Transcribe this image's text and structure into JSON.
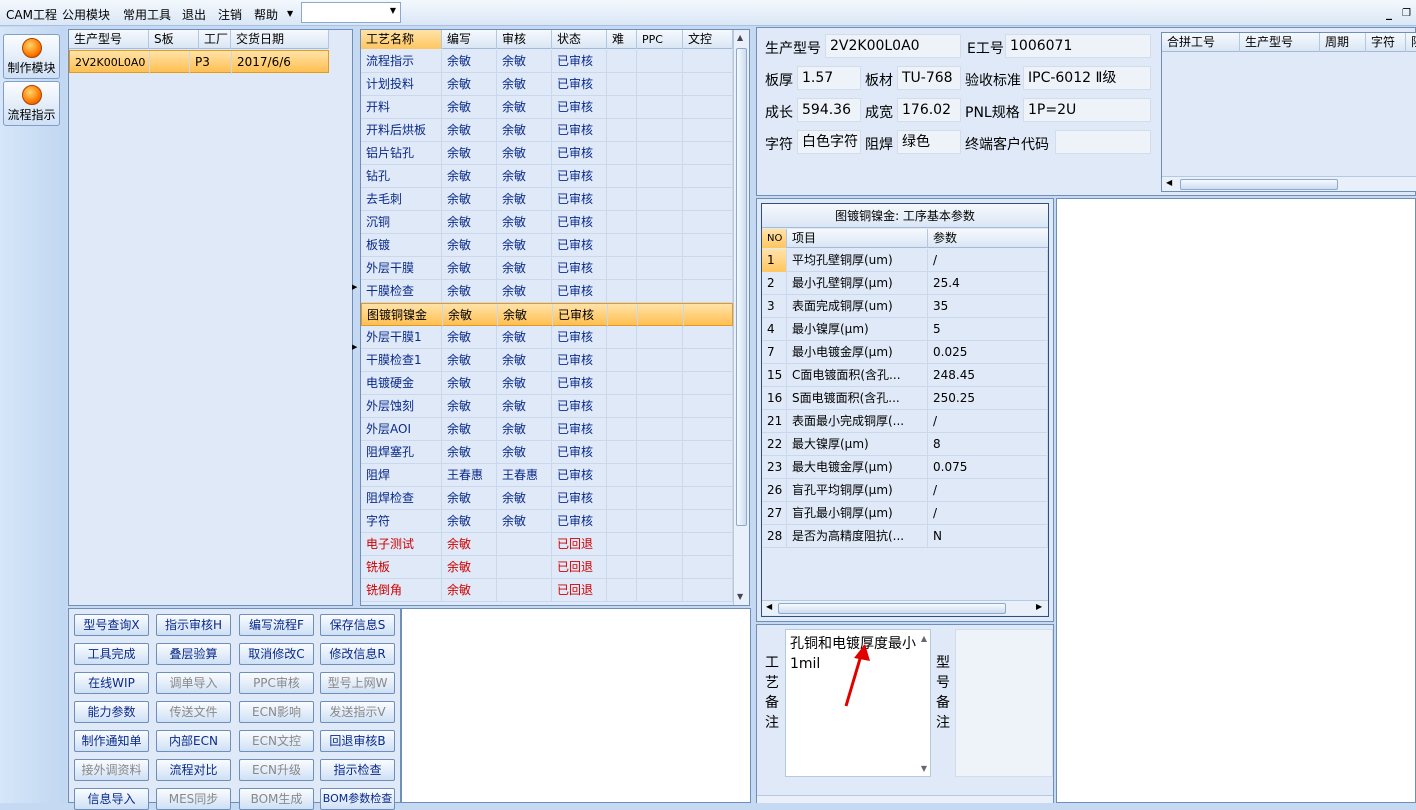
{
  "menu": {
    "items": [
      "CAM工程",
      "公用模块",
      "常用工具",
      "退出",
      "注销",
      "帮助"
    ],
    "combo_value": ""
  },
  "toolbar": {
    "make_module": "制作模块",
    "flow_guide": "流程指示"
  },
  "orders": {
    "columns": [
      "生产型号",
      "S板",
      "工厂",
      "交货日期"
    ],
    "rows": [
      {
        "model": "2V2K00L0A0",
        "s": "",
        "factory": "P3",
        "date": "2017/6/6"
      }
    ]
  },
  "process": {
    "columns": [
      "工艺名称",
      "编写",
      "审核",
      "状态",
      "难",
      "PPC",
      "文控"
    ],
    "rows": [
      {
        "name": "流程指示",
        "writer": "余敏",
        "auditor": "余敏",
        "status": "已审核"
      },
      {
        "name": "计划投料",
        "writer": "余敏",
        "auditor": "余敏",
        "status": "已审核"
      },
      {
        "name": "开料",
        "writer": "余敏",
        "auditor": "余敏",
        "status": "已审核"
      },
      {
        "name": "开料后烘板",
        "writer": "余敏",
        "auditor": "余敏",
        "status": "已审核"
      },
      {
        "name": "铝片钻孔",
        "writer": "余敏",
        "auditor": "余敏",
        "status": "已审核"
      },
      {
        "name": "钻孔",
        "writer": "余敏",
        "auditor": "余敏",
        "status": "已审核"
      },
      {
        "name": "去毛刺",
        "writer": "余敏",
        "auditor": "余敏",
        "status": "已审核"
      },
      {
        "name": "沉铜",
        "writer": "余敏",
        "auditor": "余敏",
        "status": "已审核"
      },
      {
        "name": "板镀",
        "writer": "余敏",
        "auditor": "余敏",
        "status": "已审核"
      },
      {
        "name": "外层干膜",
        "writer": "余敏",
        "auditor": "余敏",
        "status": "已审核"
      },
      {
        "name": "干膜检查",
        "writer": "余敏",
        "auditor": "余敏",
        "status": "已审核"
      },
      {
        "name": "图镀铜镍金",
        "writer": "余敏",
        "auditor": "余敏",
        "status": "已审核"
      },
      {
        "name": "外层干膜1",
        "writer": "余敏",
        "auditor": "余敏",
        "status": "已审核"
      },
      {
        "name": "干膜检查1",
        "writer": "余敏",
        "auditor": "余敏",
        "status": "已审核"
      },
      {
        "name": "电镀硬金",
        "writer": "余敏",
        "auditor": "余敏",
        "status": "已审核"
      },
      {
        "name": "外层蚀刻",
        "writer": "余敏",
        "auditor": "余敏",
        "status": "已审核"
      },
      {
        "name": "外层AOI",
        "writer": "余敏",
        "auditor": "余敏",
        "status": "已审核"
      },
      {
        "name": "阻焊塞孔",
        "writer": "余敏",
        "auditor": "余敏",
        "status": "已审核"
      },
      {
        "name": "阻焊",
        "writer": "王春惠",
        "auditor": "王春惠",
        "status": "已审核"
      },
      {
        "name": "阻焊检查",
        "writer": "余敏",
        "auditor": "余敏",
        "status": "已审核"
      },
      {
        "name": "字符",
        "writer": "余敏",
        "auditor": "余敏",
        "status": "已审核"
      },
      {
        "name": "电子测试",
        "writer": "余敏",
        "auditor": "",
        "status": "已回退"
      },
      {
        "name": "铣板",
        "writer": "余敏",
        "auditor": "",
        "status": "已回退"
      },
      {
        "name": "铣倒角",
        "writer": "余敏",
        "auditor": "",
        "status": "已回退"
      }
    ]
  },
  "buttons": [
    [
      "型号查询X",
      "指示审核H",
      "编写流程F",
      "保存信息S"
    ],
    [
      "工具完成",
      "叠层验算",
      "取消修改C",
      "修改信息R"
    ],
    [
      "在线WIP",
      "调单导入",
      "PPC审核",
      "型号上网W"
    ],
    [
      "能力参数",
      "传送文件",
      "ECN影响",
      "发送指示V"
    ],
    [
      "制作通知单",
      "内部ECN",
      "ECN文控",
      "回退审核B"
    ],
    [
      "接外调资料",
      "流程对比",
      "ECN升级",
      "指示检查"
    ],
    [
      "信息导入",
      "MES同步",
      "BOM生成",
      "BOM参数检查"
    ]
  ],
  "info": {
    "model_label": "生产型号",
    "model": "2V2K00L0A0",
    "eno_label": "E工号",
    "eno": "1006071",
    "thick_label": "板厚",
    "thick": "1.57",
    "material_label": "板材",
    "material": "TU-768",
    "std_label": "验收标准",
    "std": "IPC-6012 Ⅱ级",
    "len_label": "成长",
    "len": "594.36",
    "wid_label": "成宽",
    "wid": "176.02",
    "pnl_label": "PNL规格",
    "pnl": "1P=2U",
    "char_label": "字符",
    "char": "白色字符",
    "mask_label": "阻焊",
    "mask": "绿色",
    "cust_label": "终端客户代码",
    "cust": ""
  },
  "merge": {
    "columns": [
      "合拼工号",
      "生产型号",
      "周期",
      "字符",
      "阻"
    ]
  },
  "params": {
    "title": "图镀铜镍金: 工序基本参数",
    "columns": [
      "NO",
      "项目",
      "参数"
    ],
    "rows": [
      {
        "no": "1",
        "item": "平均孔壁铜厚(um)",
        "val": "/"
      },
      {
        "no": "2",
        "item": "最小孔壁铜厚(μm)",
        "val": "25.4"
      },
      {
        "no": "3",
        "item": "表面完成铜厚(um)",
        "val": "35"
      },
      {
        "no": "4",
        "item": "最小镍厚(μm)",
        "val": "5"
      },
      {
        "no": "7",
        "item": "最小电镀金厚(μm)",
        "val": "0.025"
      },
      {
        "no": "15",
        "item": "C面电镀面积(含孔...",
        "val": "248.45"
      },
      {
        "no": "16",
        "item": "S面电镀面积(含孔...",
        "val": "250.25"
      },
      {
        "no": "21",
        "item": "表面最小完成铜厚(...",
        "val": "/"
      },
      {
        "no": "22",
        "item": "最大镍厚(μm)",
        "val": "8"
      },
      {
        "no": "23",
        "item": "最大电镀金厚(μm)",
        "val": "0.075"
      },
      {
        "no": "26",
        "item": "盲孔平均铜厚(μm)",
        "val": "/"
      },
      {
        "no": "27",
        "item": "盲孔最小铜厚(μm)",
        "val": "/"
      },
      {
        "no": "28",
        "item": "是否为高精度阻抗(...",
        "val": "N"
      }
    ]
  },
  "notes": {
    "process_label": "工艺备注",
    "process_text": "孔铜和电镀厚度最小1mil",
    "model_label": "型号备注"
  }
}
